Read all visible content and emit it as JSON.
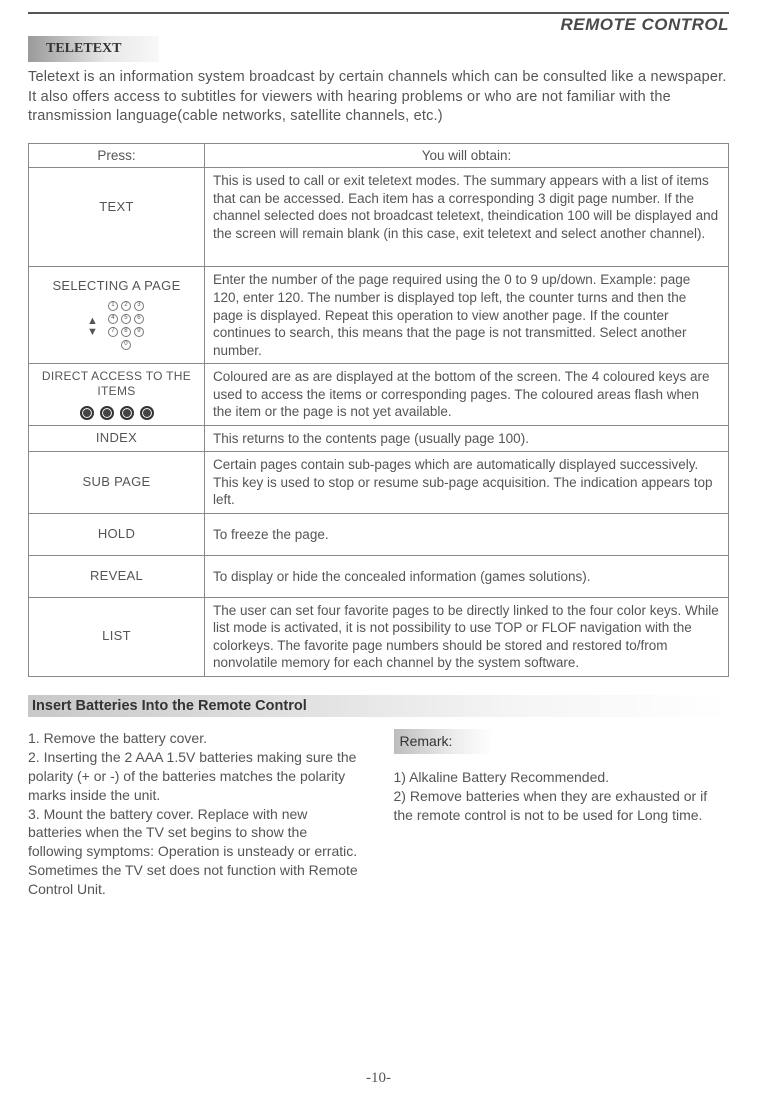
{
  "header": "REMOTE CONTROL",
  "section_tag": "TELETEXT",
  "intro": " Teletext is an information system broadcast by certain channels which can be consulted like a newspaper. It also offers access to subtitles for viewers with hearing problems or who are not familiar with the transmission language(cable networks, satellite channels, etc.)",
  "table": {
    "h1": "Press:",
    "h2": "You  will obtain:",
    "rows": [
      {
        "press": "TEXT",
        "obtain": "This is used to call or exit teletext modes. The summary appears with a list of items that can be accessed. Each item has  a  corresponding 3 digit page number. If  the channel selected does not broadcast teletext, theindication 100 will be displayed and the screen will remain blank (in this case, exit teletext and select another channel)."
      },
      {
        "press": "SELECTING  A  PAGE",
        "obtain": "Enter the number of the page required using the 0 to 9 up/down. Example: page 120, enter 120. The number is displayed top left, the counter turns and then the page is displayed. Repeat this operation to view another page. If  the counter continues to search, this means that the page is  not  transmitted. Select  another number."
      },
      {
        "press": "DIRECT   ACCESS TO THE ITEMS",
        "obtain": "Coloured are as are displayed at the bottom of the screen. The 4 coloured keys are used to access the items or corresponding  pages. The coloured areas flash when the item or the page is  not yet available."
      },
      {
        "press": "INDEX",
        "obtain": "This returns to the contents page (usually page 100)."
      },
      {
        "press": "SUB PAGE",
        "obtain": "Certain pages contain sub-pages which are automatically displayed successively. This key is used to stop or resume sub-page  acquisition. The indication  appears top left."
      },
      {
        "press": "HOLD",
        "obtain": "To freeze the page."
      },
      {
        "press": "REVEAL",
        "obtain": "To display or hide the concealed information (games solutions)."
      },
      {
        "press": "LIST",
        "obtain": "The user can set four favorite pages to be directly linked to the four color keys. While list mode is activated, it is not possibility to use TOP or FLOF navigation with the colorkeys. The favorite page numbers should be stored and restored to/from nonvolatile memory for each channel by the system software."
      }
    ]
  },
  "batt_heading": "Insert Batteries Into the Remote Control",
  "batt_steps": "1.  Remove the battery cover.\n2.  Inserting the 2 AAA 1.5V batteries making sure the polarity (+ or -) of the batteries matches the  polarity  marks inside the unit.\n3.  Mount the battery cover. Replace with new batteries when the TV set begins to show the following symptoms: Operation is unsteady or erratic. Sometimes the TV set does not function with Remote Control Unit.",
  "remark_label": "Remark:",
  "remark_body": "1) Alkaline Battery Recommended.\n2) Remove batteries when they are exhausted or if the remote control is not to be used  for   Long time.",
  "page_num": "-10-"
}
